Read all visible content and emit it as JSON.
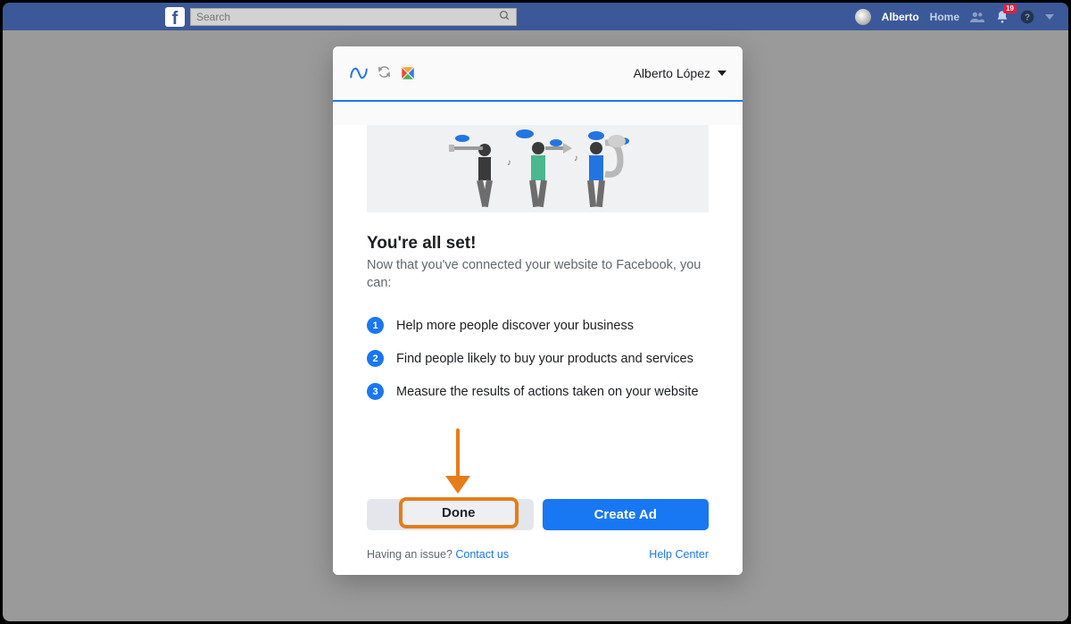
{
  "topbar": {
    "search_placeholder": "Search",
    "user_name": "Alberto",
    "home_label": "Home",
    "notification_count": "19"
  },
  "modal": {
    "user_name": "Alberto López",
    "title": "You're all set!",
    "subtitle": "Now that you've connected your website to Facebook, you can:",
    "bullets": [
      {
        "num": "1",
        "text": "Help more people discover your business"
      },
      {
        "num": "2",
        "text": "Find people likely to buy your products and services"
      },
      {
        "num": "3",
        "text": "Measure the results of actions taken on your website"
      }
    ],
    "done_label": "Done",
    "create_ad_label": "Create Ad",
    "issue_text": "Having an issue? ",
    "contact_us": "Contact us",
    "help_center": "Help Center"
  }
}
